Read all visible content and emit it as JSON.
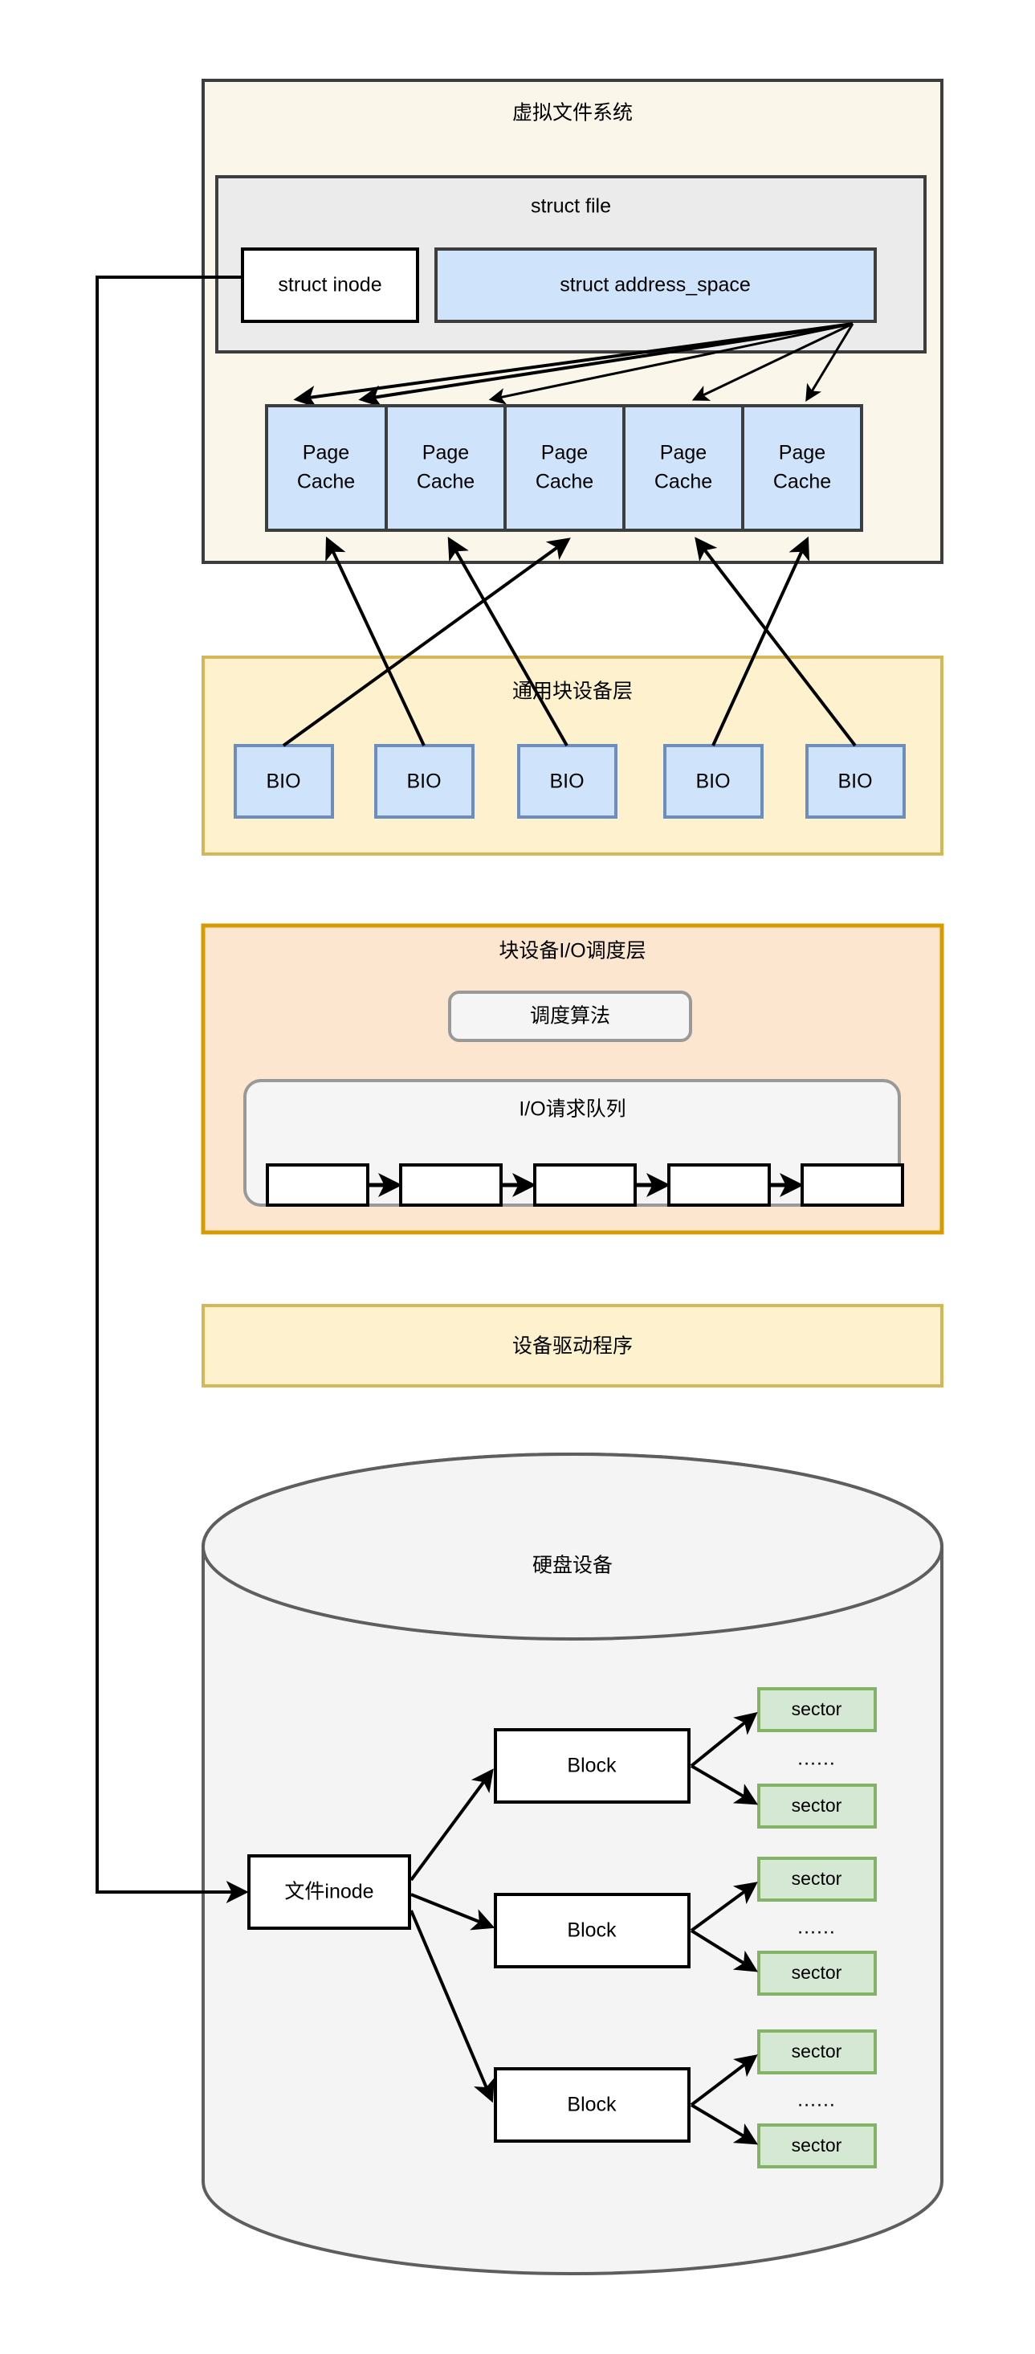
{
  "diagram": {
    "title_semantics": "linux-io-stack",
    "layers": [
      {
        "id": "vfs",
        "label": "虚拟文件系统",
        "fill": "#faf6ea",
        "stroke": "#3d3d3d"
      },
      {
        "id": "generic-block",
        "label": "通用块设备层",
        "fill": "#fdf2cd",
        "stroke": "#d6b656"
      },
      {
        "id": "io-scheduler",
        "label": "块设备I/O调度层",
        "fill": "#fde6d0",
        "stroke": "#d79b00"
      },
      {
        "id": "device-driver",
        "label": "设备驱动程序",
        "fill": "#fdf2cd",
        "stroke": "#d6b656"
      },
      {
        "id": "disk-device",
        "label": "硬盘设备",
        "fill": "#f4f4f4",
        "stroke": "#5e5e5e"
      }
    ],
    "vfs": {
      "struct_file_label": "struct file",
      "struct_inode_label": "struct inode",
      "address_space_label": "struct address_space",
      "page_cache_line1": "Page",
      "page_cache_line2": "Cache",
      "page_cache_count": 5
    },
    "generic_block": {
      "bio_label": "BIO",
      "bio_count": 5
    },
    "io_scheduler": {
      "algorithm_label": "调度算法",
      "queue_label": "I/O请求队列",
      "queue_node_count": 5
    },
    "disk": {
      "file_inode_label": "文件inode",
      "block_label": "Block",
      "block_count": 3,
      "sector_label": "sector",
      "ellipsis": "......"
    },
    "colors": {
      "blue_fill": "#cfe4fb",
      "blue_stroke": "#6c8ebf",
      "green_fill": "#d5e8d4",
      "green_stroke": "#82b366",
      "grey_fill": "#ebebeb",
      "grey_stroke": "#3d3d3d",
      "white_fill": "#ffffff",
      "black_stroke": "#000000",
      "inner_panel_fill": "#f5f5f5",
      "inner_panel_stroke": "#999999"
    }
  }
}
